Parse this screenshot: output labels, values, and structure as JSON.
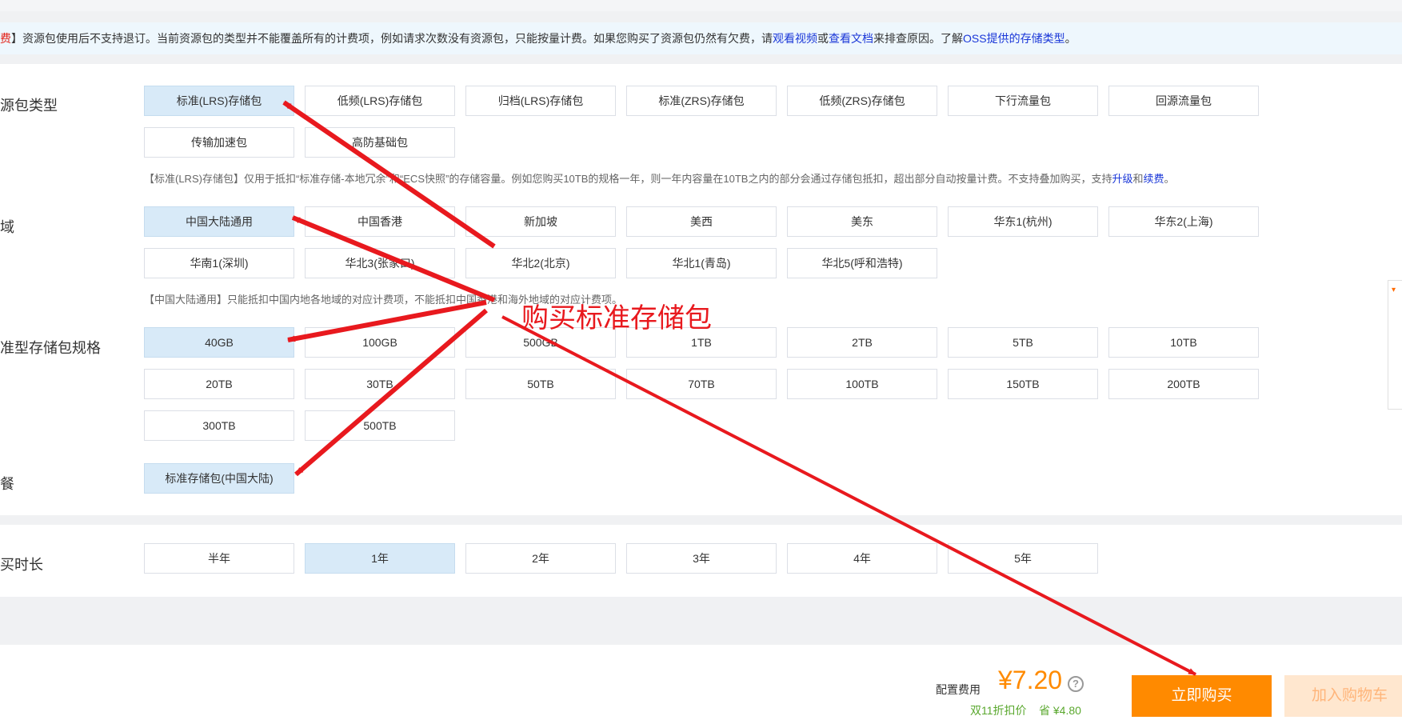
{
  "notice": {
    "p1": "】资源包使用后不支持退订。当前资源包的类型并不能覆盖所有的计费项，例如请求次数没有资源包，只能按量计费。如果您购买了资源包仍然有欠费，请",
    "l1": "观看视频",
    "p2": "或",
    "l2": "查看文档",
    "p3": "来排查原因。了解",
    "l3": "OSS提供的存储类型",
    "p4": "。",
    "prefix": "费"
  },
  "sections": {
    "package_type": {
      "label": "源包类型",
      "options": [
        "标准(LRS)存储包",
        "低频(LRS)存储包",
        "归档(LRS)存储包",
        "标准(ZRS)存储包",
        "低频(ZRS)存储包",
        "下行流量包",
        "回源流量包",
        "传输加速包",
        "高防基础包"
      ],
      "desc_p1": "【标准(LRS)存储包】仅用于抵扣“标准存储-本地冗余”和“ECS快照”的存储容量。例如您购买10TB的规格一年，则一年内容量在10TB之内的部分会通过存储包抵扣，超出部分自动按量计费。不支持叠加购买，支持",
      "desc_l1": "升级",
      "desc_p2": "和",
      "desc_l2": "续费",
      "desc_p3": "。"
    },
    "region": {
      "label": "域",
      "options": [
        "中国大陆通用",
        "中国香港",
        "新加坡",
        "美西",
        "美东",
        "华东1(杭州)",
        "华东2(上海)",
        "华南1(深圳)",
        "华北3(张家口)",
        "华北2(北京)",
        "华北1(青岛)",
        "华北5(呼和浩特)"
      ],
      "desc": "【中国大陆通用】只能抵扣中国内地各地域的对应计费项，不能抵扣中国香港和海外地域的对应计费项。"
    },
    "spec": {
      "label": "准型存储包规格",
      "options": [
        "40GB",
        "100GB",
        "500GB",
        "1TB",
        "2TB",
        "5TB",
        "10TB",
        "20TB",
        "30TB",
        "50TB",
        "70TB",
        "100TB",
        "150TB",
        "200TB",
        "300TB",
        "500TB"
      ]
    },
    "package": {
      "label": "餐",
      "options": [
        "标准存储包(中国大陆)"
      ]
    },
    "duration": {
      "label": "买时长",
      "options": [
        "半年",
        "1年",
        "2年",
        "3年",
        "4年",
        "5年"
      ]
    }
  },
  "footer": {
    "fee_label": "配置费用",
    "price": "¥7.20",
    "help": "?",
    "discount": "双11折扣价",
    "save": "省 ¥4.80",
    "buy": "立即购买",
    "cart": "加入购物车"
  },
  "annotation": {
    "text": "购买标准存储包",
    "color": "#e8191e"
  },
  "colors": {
    "selected_bg": "#d8eaf8",
    "accent_orange": "#ff8a00",
    "link_blue": "#1a37d8",
    "discount_green": "#5aa82e"
  }
}
